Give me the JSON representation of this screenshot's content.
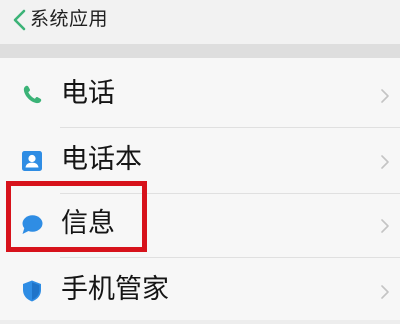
{
  "header": {
    "back_icon": "chevron-left-icon",
    "title": "系统应用"
  },
  "colors": {
    "accent_green": "#3bb377",
    "accent_blue": "#2f8de4",
    "highlight_red": "#d7121b",
    "chevron_gray": "#c4c4c4"
  },
  "list": {
    "items": [
      {
        "label": "电话",
        "icon": "phone-icon"
      },
      {
        "label": "电话本",
        "icon": "contacts-icon"
      },
      {
        "label": "信息",
        "icon": "message-icon",
        "highlighted": true
      },
      {
        "label": "手机管家",
        "icon": "shield-icon"
      }
    ]
  }
}
